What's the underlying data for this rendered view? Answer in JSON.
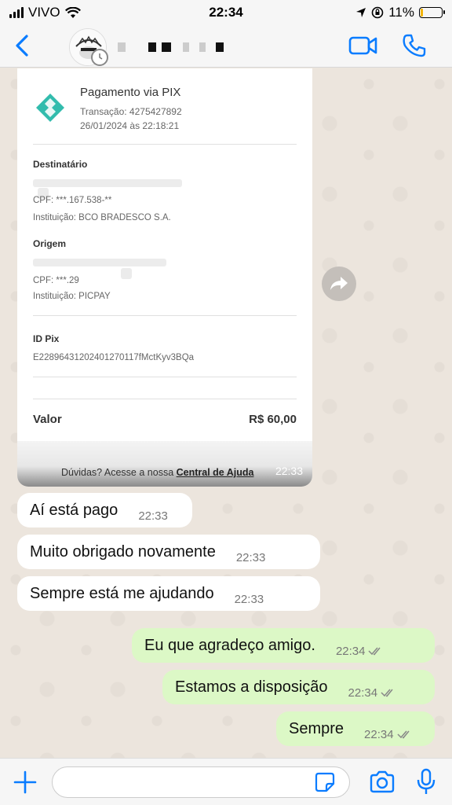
{
  "status_bar": {
    "carrier": "VIVO",
    "time": "22:34",
    "battery_percent": "11%",
    "battery_level": 0.11
  },
  "header": {
    "contact_name": "",
    "icons": [
      "back-icon",
      "avatar",
      "video-call-icon",
      "phone-icon"
    ]
  },
  "receipt": {
    "title": "Pagamento via PIX",
    "transaction": "Transação: 4275427892",
    "date": "26/01/2024 às 22:18:21",
    "destinatario_label": "Destinatário",
    "destinatario_cpf": "CPF: ***.167.538-**",
    "destinatario_inst": "Instituição: BCO BRADESCO S.A.",
    "origem_label": "Origem",
    "origem_cpf": "CPF: ***.29",
    "origem_inst": "Instituição: PICPAY",
    "idpix_label": "ID Pix",
    "idpix_value": "E22896431202401270117fMctKyv3BQa",
    "valor_label": "Valor",
    "valor_value": "R$ 60,00",
    "footer_text": "Dúvidas? Acesse a nossa ",
    "footer_link": "Central de Ajuda",
    "time": "22:33"
  },
  "messages": [
    {
      "direction": "in",
      "text": "Aí está pago",
      "time": "22:33"
    },
    {
      "direction": "in",
      "text": "Muito obrigado novamente",
      "time": "22:33"
    },
    {
      "direction": "in",
      "text": "Sempre está me ajudando",
      "time": "22:33"
    },
    {
      "direction": "out",
      "text": "Eu que agradeço amigo.",
      "time": "22:34"
    },
    {
      "direction": "out",
      "text": "Estamos a disposição",
      "time": "22:34"
    },
    {
      "direction": "out",
      "text": "Sempre",
      "time": "22:34"
    }
  ],
  "input_bar": {
    "placeholder": "",
    "icons": [
      "plus-icon",
      "sticker-icon",
      "camera-icon",
      "mic-icon"
    ]
  },
  "colors": {
    "accent": "#0a7cff",
    "outgoing_bubble": "#dcf8c6",
    "incoming_bubble": "#ffffff",
    "chat_background": "#ece5dd",
    "pix_green": "#32bcad"
  }
}
